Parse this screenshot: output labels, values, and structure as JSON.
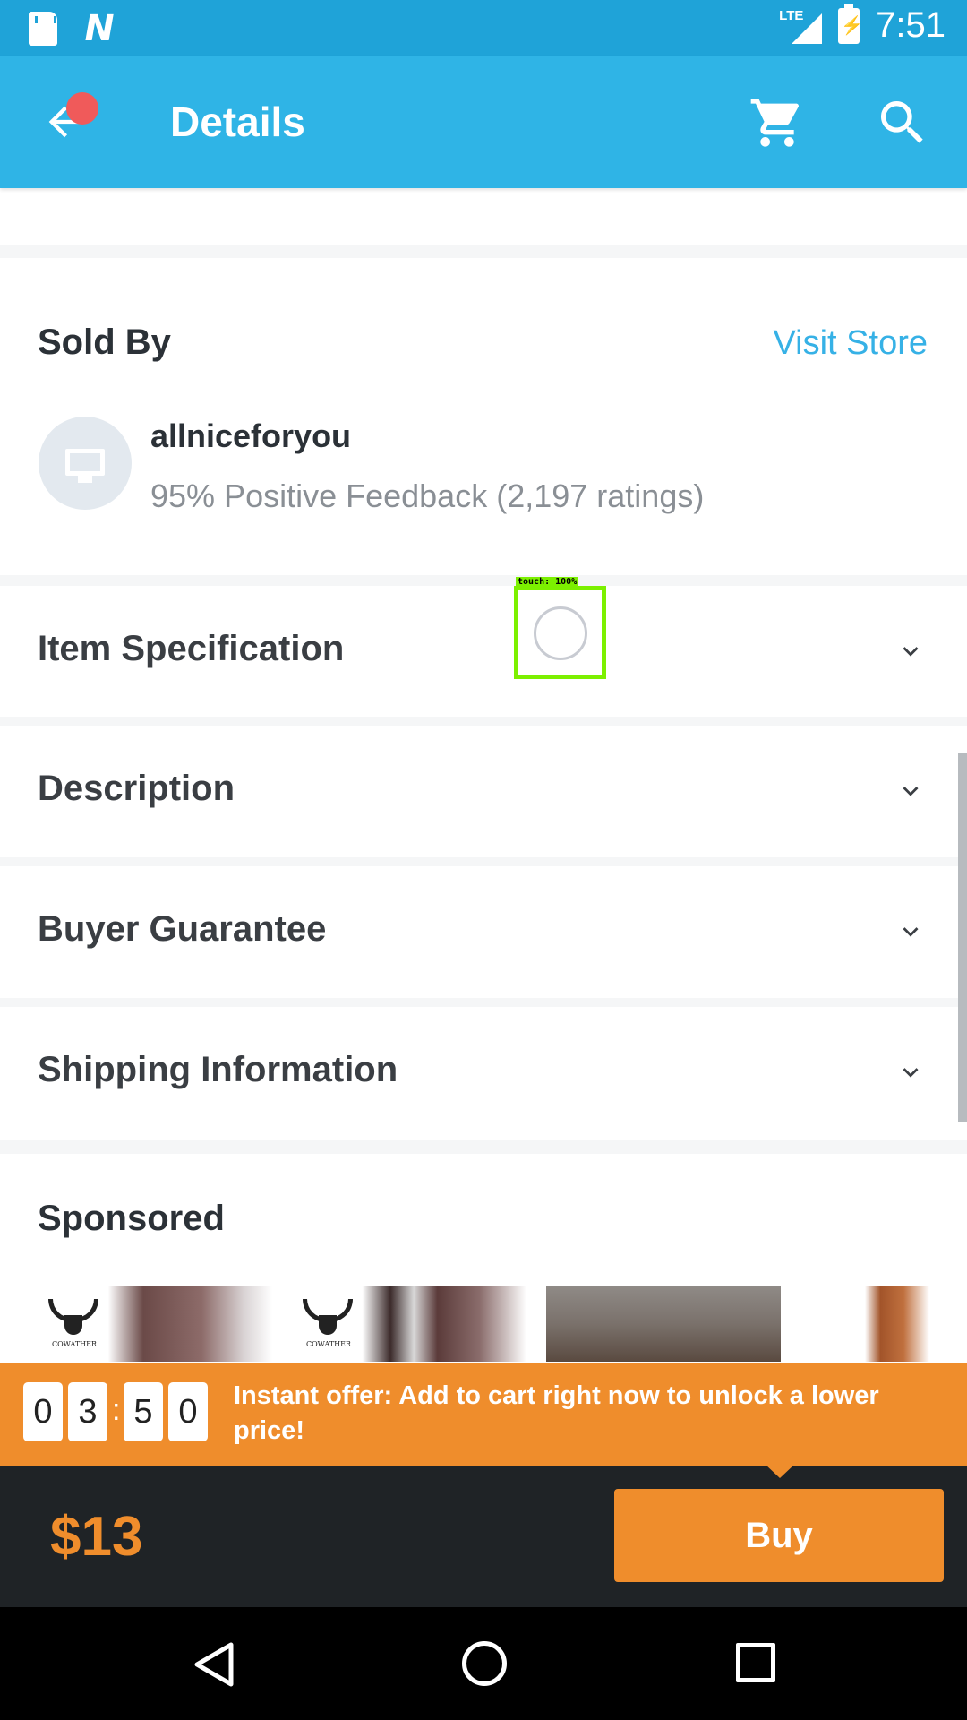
{
  "status_bar": {
    "time": "7:51",
    "network": "LTE",
    "icons": [
      "sd-card-icon",
      "n-notification-icon",
      "signal-icon",
      "battery-charging-icon"
    ]
  },
  "app_bar": {
    "title": "Details",
    "icons": [
      "back-arrow-icon",
      "cart-icon",
      "search-icon"
    ],
    "colors": {
      "background": "#2fb4e6",
      "notification_dot": "#f05a5a"
    }
  },
  "sold_by": {
    "title": "Sold By",
    "visit_store_label": "Visit Store",
    "seller_name": "allniceforyou",
    "feedback": "95% Positive Feedback (2,197 ratings)"
  },
  "accordions": [
    {
      "label": "Item Specification"
    },
    {
      "label": "Description"
    },
    {
      "label": "Buyer Guarantee"
    },
    {
      "label": "Shipping Information"
    }
  ],
  "touch_indicator": {
    "label": "touch: 100%"
  },
  "sponsored": {
    "title": "Sponsored",
    "items": [
      {
        "brand": "COWATHER"
      },
      {
        "brand": "COWATHER"
      },
      {
        "brand": ""
      },
      {
        "brand": ""
      }
    ]
  },
  "offer": {
    "countdown_digits": [
      "0",
      "3",
      "5",
      "0"
    ],
    "separator": ":",
    "text": "Instant offer: Add to cart right now to unlock a lower price!",
    "color": "#ef8d2c"
  },
  "buy_bar": {
    "price": "$13",
    "buy_label": "Buy"
  },
  "nav_bar": {
    "icons": [
      "nav-back-icon",
      "nav-home-icon",
      "nav-recents-icon"
    ]
  }
}
